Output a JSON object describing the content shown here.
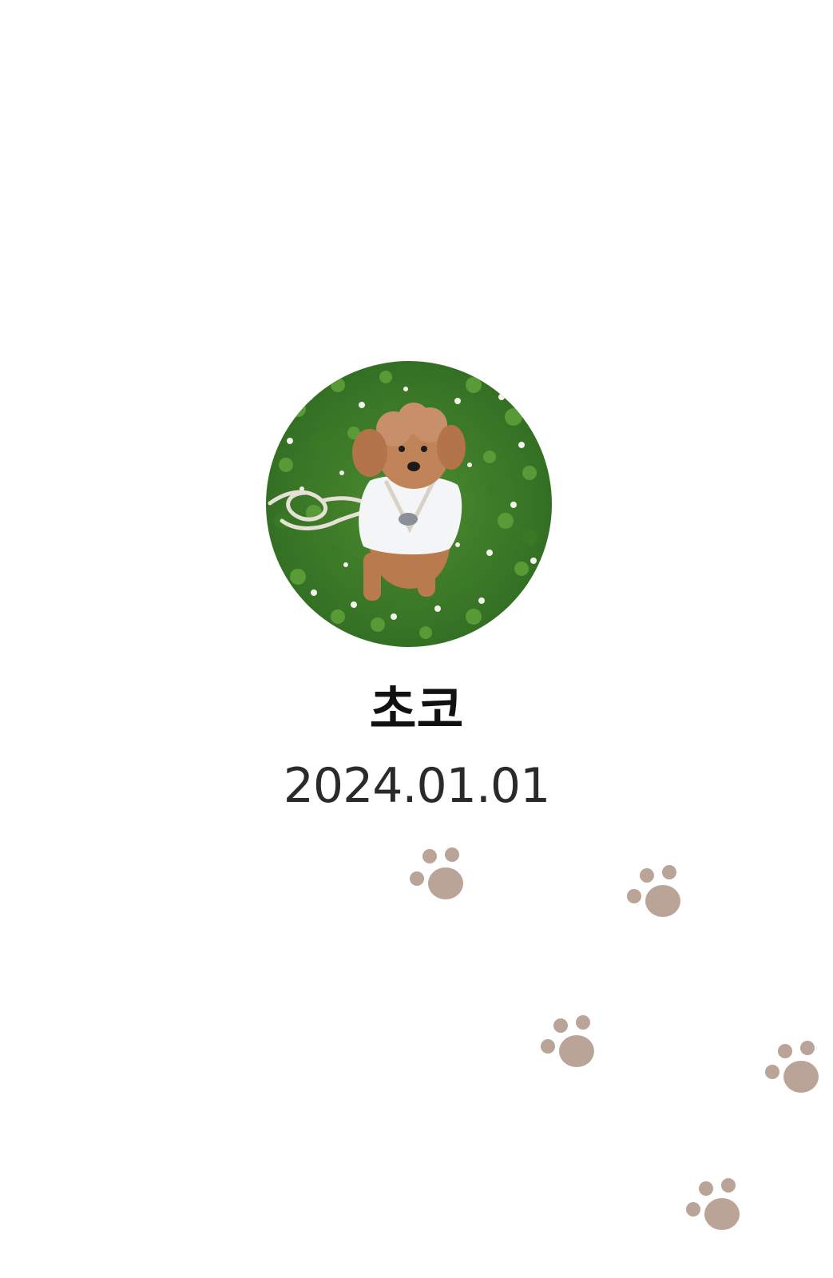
{
  "profile": {
    "name": "초코",
    "date": "2024.01.01",
    "photo_description_icon": "dog-photo"
  },
  "decor": {
    "paw_color": "#b9a497",
    "paw_icon": "paw-print-icon"
  }
}
